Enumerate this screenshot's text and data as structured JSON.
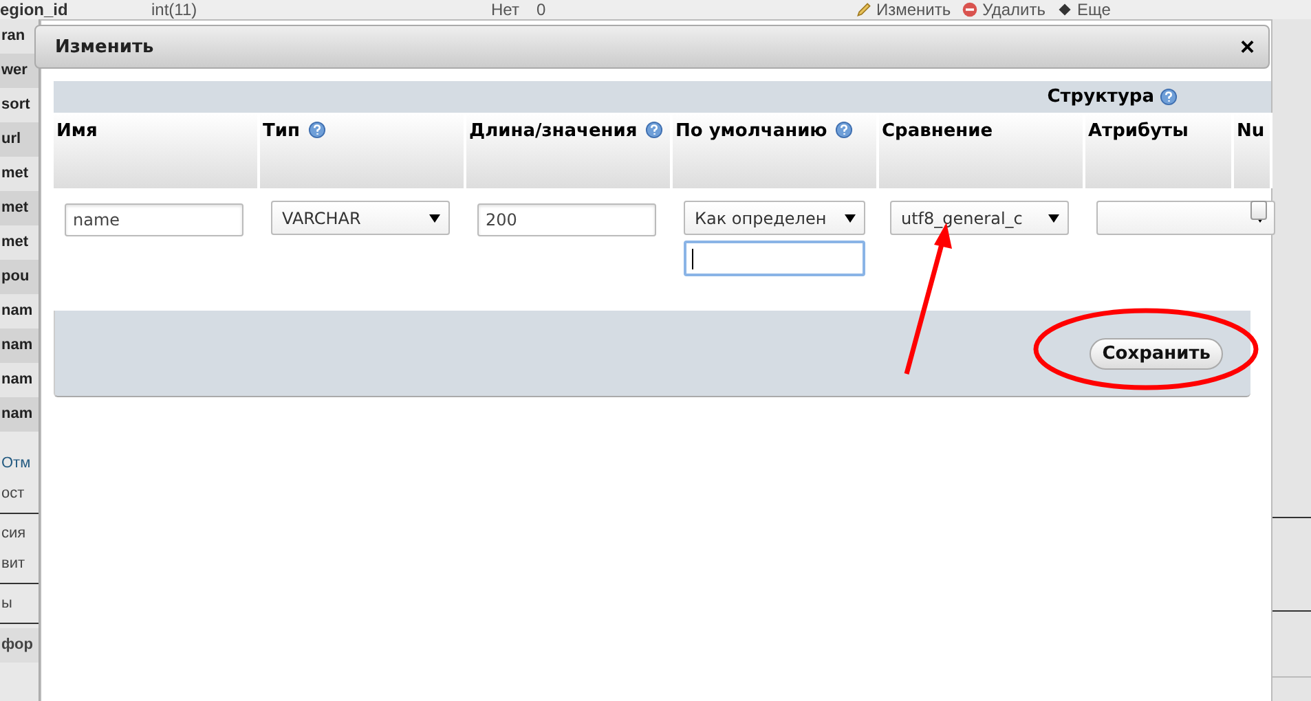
{
  "background_row": {
    "cells": [
      "egion_id",
      "int(11)",
      "Нет",
      "0"
    ],
    "actions": [
      {
        "kind": "edit",
        "label": "Изменить"
      },
      {
        "kind": "delete",
        "label": "Удалить"
      },
      {
        "kind": "more",
        "label": "Еще"
      }
    ]
  },
  "left_panel": [
    {
      "kind": "field",
      "text": "ran",
      "divider_before": false
    },
    {
      "kind": "field",
      "text": "wer",
      "divider_before": false
    },
    {
      "kind": "field",
      "text": "sort",
      "divider_before": false
    },
    {
      "kind": "field",
      "text": "url",
      "divider_before": false
    },
    {
      "kind": "field",
      "text": "met",
      "divider_before": false
    },
    {
      "kind": "field",
      "text": "met",
      "divider_before": false
    },
    {
      "kind": "field",
      "text": "met",
      "divider_before": false
    },
    {
      "kind": "field",
      "text": "pou",
      "divider_before": false
    },
    {
      "kind": "field",
      "text": "nam",
      "divider_before": false
    },
    {
      "kind": "field",
      "text": "nam",
      "divider_before": false
    },
    {
      "kind": "field",
      "text": "nam",
      "divider_before": false
    },
    {
      "kind": "field",
      "text": "nam",
      "divider_before": false
    },
    {
      "kind": "link",
      "text": "Отм",
      "divider_before": false
    },
    {
      "kind": "text",
      "text": "ост",
      "divider_before": false
    },
    {
      "kind": "text",
      "text": "сия",
      "divider_before": true
    },
    {
      "kind": "text",
      "text": "вит",
      "divider_before": false
    },
    {
      "kind": "text",
      "text": "ы",
      "divider_before": true
    },
    {
      "kind": "heading",
      "text": "фор",
      "divider_before": true
    }
  ],
  "dialog": {
    "title": "Изменить",
    "close": "×",
    "section_title": "Структура",
    "columns": [
      {
        "label": "Имя",
        "help": false
      },
      {
        "label": "Тип",
        "help": true
      },
      {
        "label": "Длина/значения",
        "help": true
      },
      {
        "label": "По умолчанию",
        "help": true
      },
      {
        "label": "Сравнение",
        "help": false
      },
      {
        "label": "Атрибуты",
        "help": false
      },
      {
        "label": "Nu",
        "help": false
      }
    ],
    "fields": [
      {
        "kind": "text",
        "value": "name"
      },
      {
        "kind": "select",
        "value": "VARCHAR"
      },
      {
        "kind": "text",
        "value": "200"
      },
      {
        "kind": "select-with-input",
        "value": "Как определен",
        "input_focused": true
      },
      {
        "kind": "select",
        "value": "utf8_general_c"
      },
      {
        "kind": "select"
      },
      {
        "kind": "checkbox",
        "checked": false
      }
    ],
    "save_button": "Сохранить"
  },
  "annotations": [
    {
      "kind": "arrow"
    },
    {
      "kind": "ellipse"
    }
  ]
}
